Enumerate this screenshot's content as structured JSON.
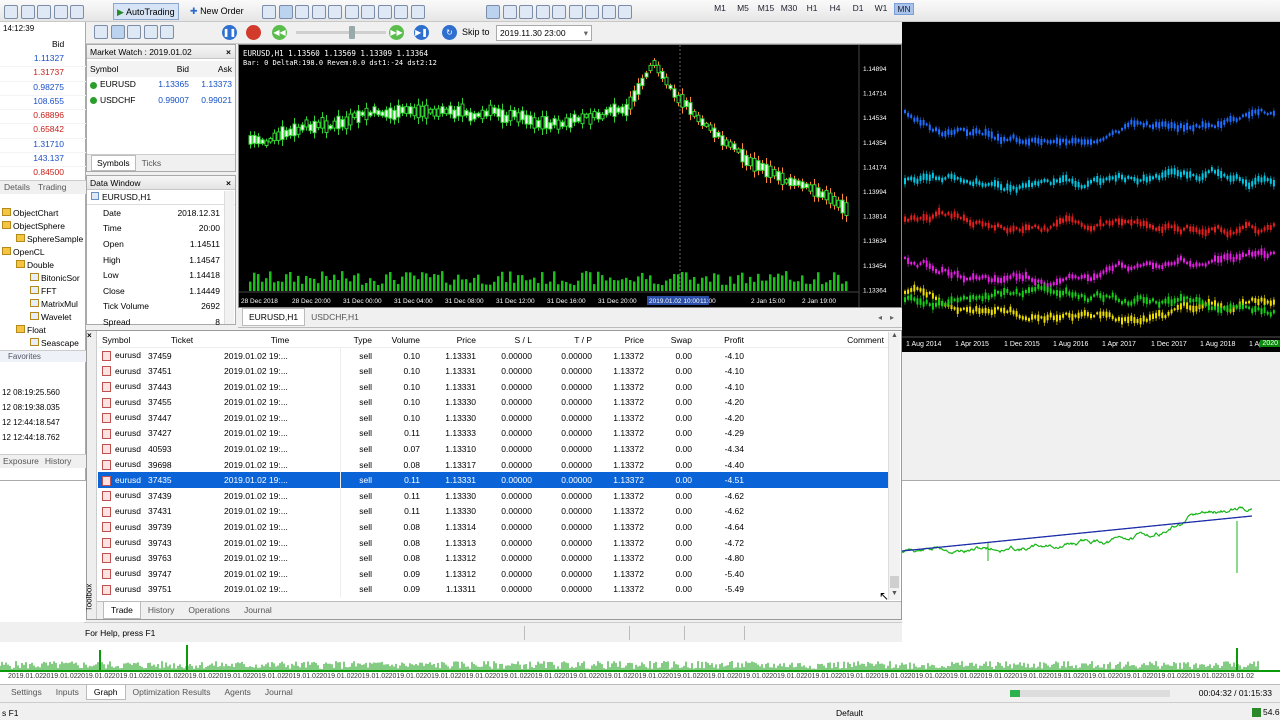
{
  "toolbar": {
    "autotrading": "AutoTrading",
    "new_order": "New Order",
    "timeframes": [
      "M1",
      "M5",
      "M15",
      "M30",
      "H1",
      "H4",
      "D1",
      "W1",
      "MN"
    ],
    "active_tf": "MN"
  },
  "tester_bar": {
    "skip_to_label": "Skip to",
    "skip_to_value": "2019.11.30 23:00"
  },
  "left_strip": {
    "clock": "14:12:39",
    "bid_header": "Bid",
    "bids": [
      "1.11327",
      "1.31737",
      "0.98275",
      "108.655",
      "0.68896",
      "0.65842",
      "1.31710",
      "143.137",
      "0.84500"
    ],
    "tabs": [
      "Details",
      "Trading"
    ],
    "tree": [
      "ObjectChart",
      "ObjectSphere",
      "SphereSample",
      "OpenCL",
      "Double",
      "BitonicSor",
      "FFT",
      "MatrixMul",
      "Wavelet",
      "Float",
      "Seascape"
    ],
    "favorites": "Favorites",
    "log": [
      "12 08:19:25.560",
      "12 08:19:38.035",
      "12 12:44:18.547",
      "12 12:44:18.762"
    ],
    "bottom_tabs": [
      "Exposure",
      "History"
    ]
  },
  "market_watch": {
    "title": "Market Watch : 2019.01.02",
    "cols": [
      "Symbol",
      "Bid",
      "Ask"
    ],
    "rows": [
      {
        "symbol": "EURUSD",
        "bid": "1.13365",
        "ask": "1.13373"
      },
      {
        "symbol": "USDCHF",
        "bid": "0.99007",
        "ask": "0.99021"
      }
    ],
    "tabs": [
      "Symbols",
      "Ticks"
    ]
  },
  "data_window": {
    "title": "Data Window",
    "symbol": "EURUSD,H1",
    "rows": [
      {
        "k": "Date",
        "v": "2018.12.31"
      },
      {
        "k": "Time",
        "v": "20:00"
      },
      {
        "k": "Open",
        "v": "1.14511"
      },
      {
        "k": "High",
        "v": "1.14547"
      },
      {
        "k": "Low",
        "v": "1.14418"
      },
      {
        "k": "Close",
        "v": "1.14449"
      },
      {
        "k": "Tick Volume",
        "v": "2692"
      },
      {
        "k": "Spread",
        "v": "8"
      }
    ]
  },
  "chart": {
    "title": "EURUSD,H1  1.13560 1.13569 1.13309 1.13364",
    "subtitle": "Bar: 0 DeltaR:198.0 Revem:0.0 dst1:-24 dst2:12",
    "price_labels": [
      "1.14894",
      "1.14714",
      "1.14534",
      "1.14354",
      "1.14174",
      "1.13994",
      "1.13814",
      "1.13634",
      "1.13454",
      "1.13364"
    ],
    "time_labels": [
      "28 Dec 2018",
      "28 Dec 20:00",
      "31 Dec 00:00",
      "31 Dec 04:00",
      "31 Dec 08:00",
      "31 Dec 12:00",
      "31 Dec 16:00",
      "31 Dec 20:00",
      "2019.01.02 10:00",
      "11:00",
      "2 Jan 15:00",
      "2 Jan 19:00"
    ],
    "tabs": [
      "EURUSD,H1",
      "USDCHF,H1"
    ]
  },
  "right_chart": {
    "labels": [
      "1 Aug 2014",
      "1 Apr 2015",
      "1 Dec 2015",
      "1 Aug 2016",
      "1 Apr 2017",
      "1 Dec 2017",
      "1 Aug 2018",
      "1 Apr 20"
    ],
    "tag": "2020"
  },
  "trade": {
    "cols": [
      "Symbol",
      "Ticket",
      "Time",
      "Type",
      "Volume",
      "Price",
      "S / L",
      "T / P",
      "Price",
      "Swap",
      "Profit",
      "Comment"
    ],
    "rows": [
      [
        "eurusd",
        "37459",
        "2019.01.02 19:...",
        "sell",
        "0.10",
        "1.13331",
        "0.00000",
        "0.00000",
        "1.13372",
        "0.00",
        "-4.10"
      ],
      [
        "eurusd",
        "37451",
        "2019.01.02 19:...",
        "sell",
        "0.10",
        "1.13331",
        "0.00000",
        "0.00000",
        "1.13372",
        "0.00",
        "-4.10"
      ],
      [
        "eurusd",
        "37443",
        "2019.01.02 19:...",
        "sell",
        "0.10",
        "1.13331",
        "0.00000",
        "0.00000",
        "1.13372",
        "0.00",
        "-4.10"
      ],
      [
        "eurusd",
        "37455",
        "2019.01.02 19:...",
        "sell",
        "0.10",
        "1.13330",
        "0.00000",
        "0.00000",
        "1.13372",
        "0.00",
        "-4.20"
      ],
      [
        "eurusd",
        "37447",
        "2019.01.02 19:...",
        "sell",
        "0.10",
        "1.13330",
        "0.00000",
        "0.00000",
        "1.13372",
        "0.00",
        "-4.20"
      ],
      [
        "eurusd",
        "37427",
        "2019.01.02 19:...",
        "sell",
        "0.11",
        "1.13333",
        "0.00000",
        "0.00000",
        "1.13372",
        "0.00",
        "-4.29"
      ],
      [
        "eurusd",
        "40593",
        "2019.01.02 19:...",
        "sell",
        "0.07",
        "1.13310",
        "0.00000",
        "0.00000",
        "1.13372",
        "0.00",
        "-4.34"
      ],
      [
        "eurusd",
        "39698",
        "2019.01.02 19:...",
        "sell",
        "0.08",
        "1.13317",
        "0.00000",
        "0.00000",
        "1.13372",
        "0.00",
        "-4.40"
      ],
      [
        "eurusd",
        "37435",
        "2019.01.02 19:...",
        "sell",
        "0.11",
        "1.13331",
        "0.00000",
        "0.00000",
        "1.13372",
        "0.00",
        "-4.51"
      ],
      [
        "eurusd",
        "37439",
        "2019.01.02 19:...",
        "sell",
        "0.11",
        "1.13330",
        "0.00000",
        "0.00000",
        "1.13372",
        "0.00",
        "-4.62"
      ],
      [
        "eurusd",
        "37431",
        "2019.01.02 19:...",
        "sell",
        "0.11",
        "1.13330",
        "0.00000",
        "0.00000",
        "1.13372",
        "0.00",
        "-4.62"
      ],
      [
        "eurusd",
        "39739",
        "2019.01.02 19:...",
        "sell",
        "0.08",
        "1.13314",
        "0.00000",
        "0.00000",
        "1.13372",
        "0.00",
        "-4.64"
      ],
      [
        "eurusd",
        "39743",
        "2019.01.02 19:...",
        "sell",
        "0.08",
        "1.13313",
        "0.00000",
        "0.00000",
        "1.13372",
        "0.00",
        "-4.72"
      ],
      [
        "eurusd",
        "39763",
        "2019.01.02 19:...",
        "sell",
        "0.08",
        "1.13312",
        "0.00000",
        "0.00000",
        "1.13372",
        "0.00",
        "-4.80"
      ],
      [
        "eurusd",
        "39747",
        "2019.01.02 19:...",
        "sell",
        "0.09",
        "1.13312",
        "0.00000",
        "0.00000",
        "1.13372",
        "0.00",
        "-5.40"
      ],
      [
        "eurusd",
        "39751",
        "2019.01.02 19:...",
        "sell",
        "0.09",
        "1.13311",
        "0.00000",
        "0.00000",
        "1.13372",
        "0.00",
        "-5.49"
      ]
    ],
    "selected_index": 8,
    "tabs": [
      "Trade",
      "History",
      "Operations",
      "Journal"
    ],
    "toolbox": "Toolbox"
  },
  "status": {
    "help": "For Help, press F1"
  },
  "bottom": {
    "date_label": "2019.01.02",
    "tabs": [
      "Settings",
      "Inputs",
      "Graph",
      "Optimization Results",
      "Agents",
      "Journal"
    ],
    "active_tab": "Graph",
    "time": "00:04:32 / 01:15:33",
    "profile": "Default",
    "left_status": "s F1",
    "pct": "54.6"
  }
}
